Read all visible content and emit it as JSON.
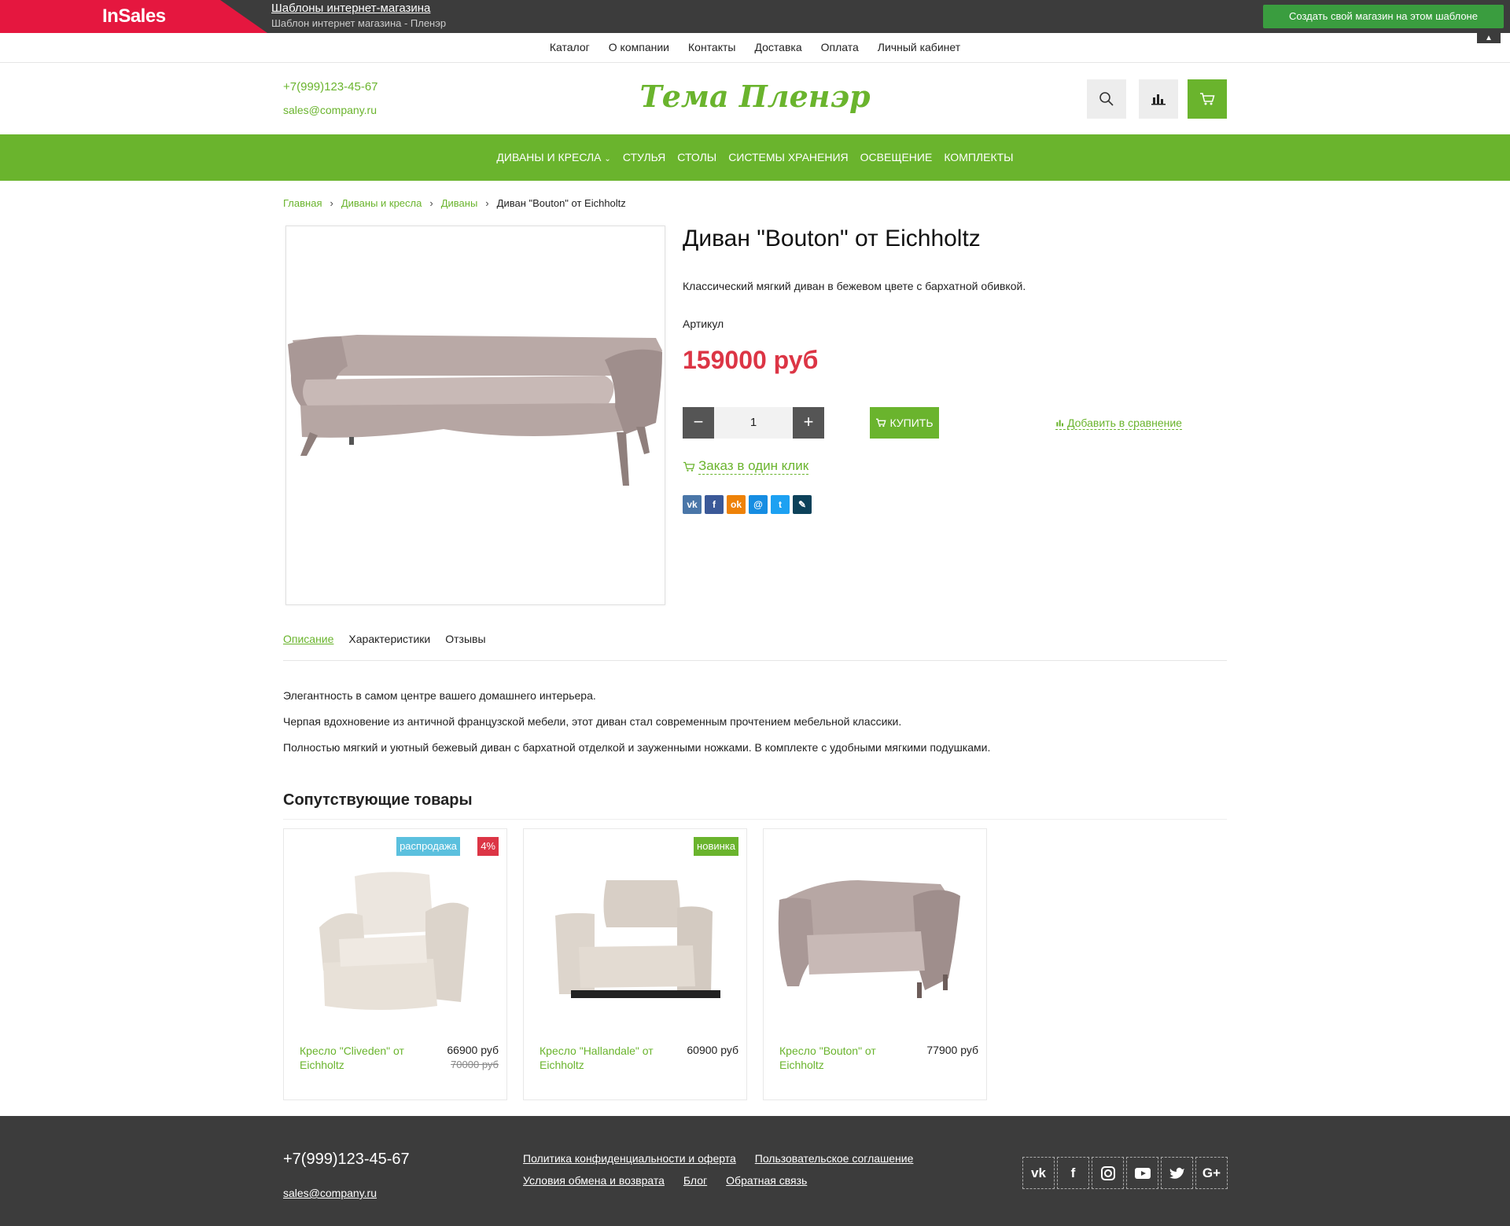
{
  "insales": {
    "logo": "InSales",
    "title": "Шаблоны интернет-магазина",
    "subtitle": "Шаблон интернет магазина - Пленэр",
    "create_button": "Создать свой магазин на этом шаблоне",
    "brand_color": "#e5173f"
  },
  "topnav": [
    "Каталог",
    "О компании",
    "Контакты",
    "Доставка",
    "Оплата",
    "Личный кабинет"
  ],
  "header": {
    "phone": "+7(999)123-45-67",
    "email": "sales@company.ru",
    "logo": "Тема Пленэр",
    "icons": [
      "search-icon",
      "compare-icon",
      "cart-icon"
    ]
  },
  "catnav": [
    "Диваны и кресла",
    "Стулья",
    "Столы",
    "Системы хранения",
    "Освещение",
    "Комплекты"
  ],
  "breadcrumb": [
    "Главная",
    "Диваны и кресла",
    "Диваны",
    "Диван \"Bouton\" от Eichholtz"
  ],
  "product": {
    "title": "Диван \"Bouton\" от Eichholtz",
    "description": "Классический мягкий диван в бежевом цвете с бархатной обивкой.",
    "sku_label": "Артикул",
    "price": "159000 руб",
    "qty": "1",
    "buy_label": "КУПИТЬ",
    "compare_label": "Добавить в сравнение",
    "oneclick_label": "Заказ в один клик",
    "share": [
      "vk-icon",
      "facebook-icon",
      "odnoklassniki-icon",
      "moimir-icon",
      "twitter-icon",
      "livejournal-icon"
    ]
  },
  "tabs": [
    "Описание",
    "Характеристики",
    "Отзывы"
  ],
  "description": [
    "Элегантность в самом центре вашего домашнего интерьера.",
    "Черпая вдохновение из античной французской мебели, этот диван стал современным прочтением мебельной классики.",
    "Полностью мягкий и уютный бежевый диван с бархатной отделкой и зауженными ножками. В комплекте с удобными мягкими подушками."
  ],
  "related_title": "Сопутствующие товары",
  "related": [
    {
      "name": "Кресло \"Cliveden\" от Eichholtz",
      "price": "66900 руб",
      "old_price": "70000 руб",
      "labels": [
        "распродажа",
        "4%"
      ]
    },
    {
      "name": "Кресло \"Hallandale\" от Eichholtz",
      "price": "60900 руб",
      "old_price": "",
      "labels": [
        "новинка"
      ]
    },
    {
      "name": "Кресло \"Bouton\" от Eichholtz",
      "price": "77900 руб",
      "old_price": "",
      "labels": []
    }
  ],
  "footer": {
    "phone": "+7(999)123-45-67",
    "email": "sales@company.ru",
    "links": [
      "Политика конфиденциальности и оферта",
      "Пользовательское соглашение",
      "Условия обмена и возврата",
      "Блог",
      "Обратная связь"
    ],
    "social": [
      "vk-icon",
      "facebook-icon",
      "instagram-icon",
      "youtube-icon",
      "twitter-icon",
      "google-plus-icon"
    ]
  },
  "colors": {
    "accent": "#6ab42d",
    "price": "#dc3545",
    "dark": "#3c3c3c"
  }
}
